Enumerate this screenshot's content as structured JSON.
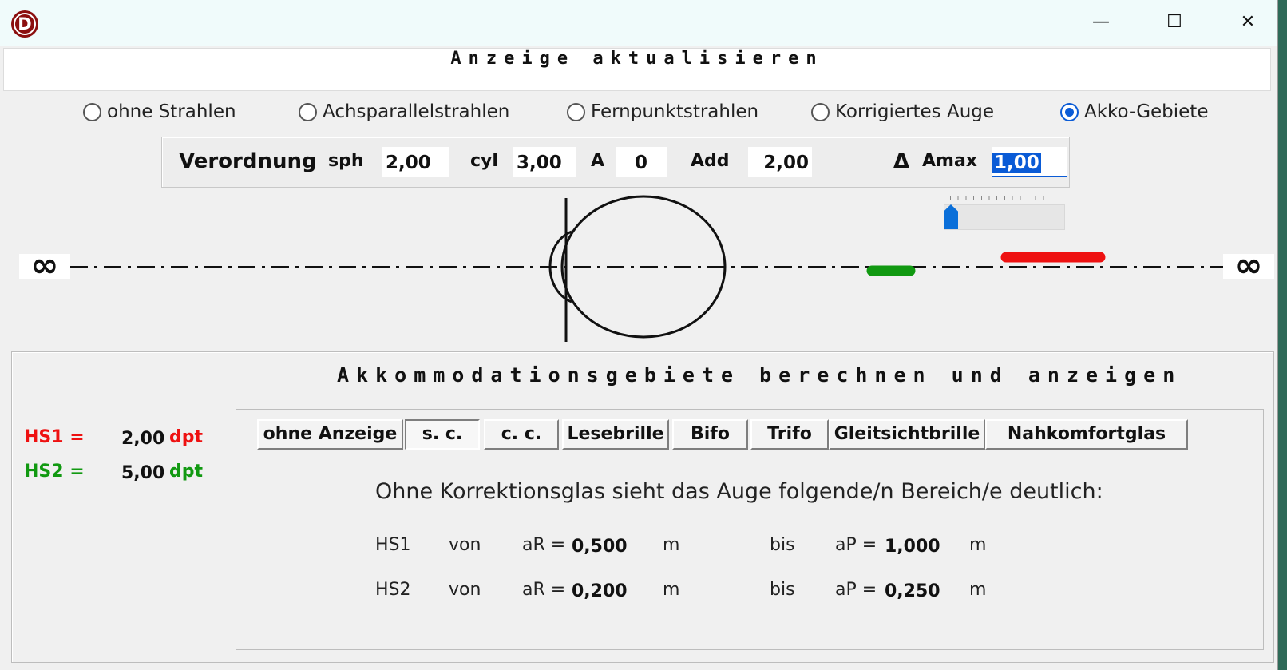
{
  "window": {
    "app_icon_letter": "D",
    "minimize": "—",
    "maximize": "☐",
    "close": "✕"
  },
  "update_button": "Anzeige aktualisieren",
  "ray_options": [
    {
      "label": "ohne Strahlen",
      "selected": false
    },
    {
      "label": "Achsparallelstrahlen",
      "selected": false
    },
    {
      "label": "Fernpunktstrahlen",
      "selected": false
    },
    {
      "label": "Korrigiertes Auge",
      "selected": false
    },
    {
      "label": "Akko-Gebiete",
      "selected": true
    }
  ],
  "prescription": {
    "title": "Verordnung",
    "sph_label": "sph",
    "sph_value": "2,00",
    "cyl_label": "cyl",
    "cyl_value": "3,00",
    "axis_label": "A",
    "axis_value": "0",
    "add_label": "Add",
    "add_value": "2,00",
    "delta_symbol": "Δ",
    "amax_label": "Amax",
    "amax_value": "1,00"
  },
  "amax_slider": {
    "level": 0.0
  },
  "diagram": {
    "infinity_left": "∞",
    "infinity_right": "∞",
    "colors": {
      "hs1": "#ee1111",
      "hs2": "#119911"
    }
  },
  "accommodation": {
    "title": "Akkommodationsgebiete berechnen und anzeigen",
    "hs1_label": "HS1 =",
    "hs1_value": "2,00",
    "hs1_unit": "dpt",
    "hs2_label": "HS2 =",
    "hs2_value": "5,00",
    "hs2_unit": "dpt",
    "tabs": [
      {
        "label": "ohne Anzeige",
        "active": false
      },
      {
        "label": "s. c.",
        "active": true
      },
      {
        "label": "c. c.",
        "active": false
      },
      {
        "label": "Lesebrille",
        "active": false
      },
      {
        "label": "Bifo",
        "active": false
      },
      {
        "label": "Trifo",
        "active": false
      },
      {
        "label": "Gleitsichtbrille",
        "active": false
      },
      {
        "label": "Nahkomfortglas",
        "active": false
      }
    ],
    "message": "Ohne Korrektionsglas sieht das Auge folgende/n Bereich/e deutlich:",
    "rows": [
      {
        "name": "HS1",
        "von": "von",
        "ar_label": "aR =",
        "ar_value": "0,500",
        "unit1": "m",
        "bis": "bis",
        "ap_label": "aP =",
        "ap_value": "1,000",
        "unit2": "m"
      },
      {
        "name": "HS2",
        "von": "von",
        "ar_label": "aR =",
        "ar_value": "0,200",
        "unit1": "m",
        "bis": "bis",
        "ap_label": "aP =",
        "ap_value": "0,250",
        "unit2": "m"
      }
    ]
  }
}
